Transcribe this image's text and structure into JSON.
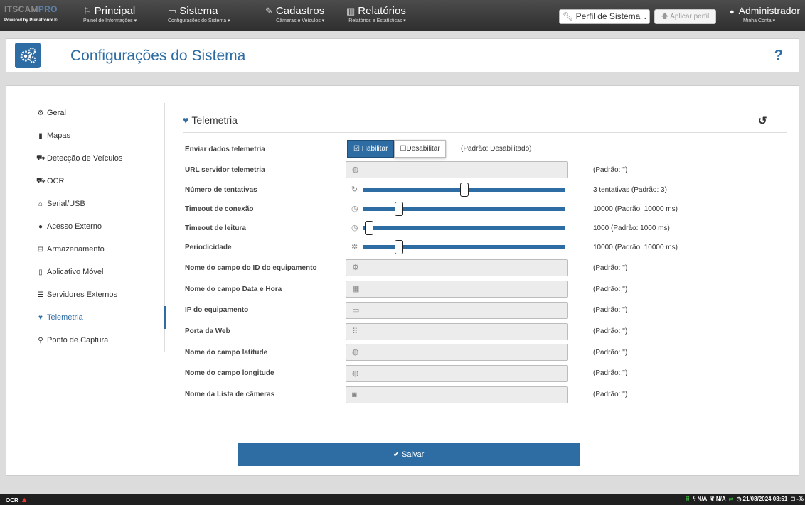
{
  "brand": {
    "line1_a": "ITSCAM",
    "line1_b": "PRO",
    "powered": "Powered by Pumatronix ®"
  },
  "nav": [
    {
      "icon": "flag-icon",
      "glyph": "⚐",
      "title": "Principal",
      "subtitle": "Painel de Informações ▾"
    },
    {
      "icon": "monitor-icon",
      "glyph": "▭",
      "title": "Sistema",
      "subtitle": "Configurações do Sistema ▾"
    },
    {
      "icon": "edit-icon",
      "glyph": "✎",
      "title": "Cadastros",
      "subtitle": "Câmeras e Veículos ▾"
    },
    {
      "icon": "bar-chart-icon",
      "glyph": "▥",
      "title": "Relatórios",
      "subtitle": "Relatórios e Estatísticas ▾"
    }
  ],
  "profile": {
    "select_label": "Perfil de Sistema",
    "apply_label": "Aplicar perfil"
  },
  "user": {
    "name": "Administrador",
    "account": "Minha Conta ▾"
  },
  "page": {
    "title": "Configurações do Sistema",
    "help": "?"
  },
  "sidebar": [
    {
      "icon": "cogs-icon",
      "glyph": "⚙",
      "label": "Geral"
    },
    {
      "icon": "map-icon",
      "glyph": "▮",
      "label": "Mapas"
    },
    {
      "icon": "car-icon",
      "glyph": "⛟",
      "label": "Detecção de Veículos"
    },
    {
      "icon": "car-icon",
      "glyph": "⛟",
      "label": "OCR"
    },
    {
      "icon": "plug-icon",
      "glyph": "⌂",
      "label": "Serial/USB"
    },
    {
      "icon": "globe-icon",
      "glyph": "●",
      "label": "Acesso Externo"
    },
    {
      "icon": "hdd-icon",
      "glyph": "⊟",
      "label": "Armazenamento"
    },
    {
      "icon": "mobile-icon",
      "glyph": "▯",
      "label": "Aplicativo Móvel"
    },
    {
      "icon": "server-icon",
      "glyph": "☰",
      "label": "Servidores Externos"
    },
    {
      "icon": "heartbeat-icon",
      "glyph": "♥",
      "label": "Telemetria"
    },
    {
      "icon": "map-marker-icon",
      "glyph": "⚲",
      "label": "Ponto de Captura"
    }
  ],
  "section": {
    "title": "Telemetria",
    "reset_glyph": "↺"
  },
  "enable": {
    "label": "Enviar dados telemetria",
    "on_label": "Habilitar",
    "off_label": "Desabilitar",
    "default_text": "(Padrão: Desabilitado)",
    "enabled": true
  },
  "url_field": {
    "label": "URL servidor telemetria",
    "icon": "globe-icon",
    "glyph": "◍",
    "value": "",
    "hint": "(Padrão: '')"
  },
  "sliders": [
    {
      "label": "Número de tentativas",
      "icon": "refresh-icon",
      "glyph": "↻",
      "level": 0.5,
      "hint": "3 tentativas  (Padrão: 3)"
    },
    {
      "label": "Timeout de conexão",
      "icon": "clock-icon",
      "glyph": "◷",
      "level": 0.18,
      "hint": "10000  (Padrão: 10000 ms)"
    },
    {
      "label": "Timeout de leitura",
      "icon": "clock-icon",
      "glyph": "◷",
      "level": 0.03,
      "hint": "1000  (Padrão: 1000 ms)"
    },
    {
      "label": "Periodicidade",
      "icon": "cog-icon",
      "glyph": "✲",
      "level": 0.18,
      "hint": "10000  (Padrão: 10000 ms)"
    }
  ],
  "fields": [
    {
      "label": "Nome do campo do ID do equipamento",
      "icon": "cogs-icon",
      "glyph": "⚙",
      "value": "",
      "hint": "(Padrão: '')"
    },
    {
      "label": "Nome do campo Data e Hora",
      "icon": "calendar-icon",
      "glyph": "▦",
      "value": "",
      "hint": "(Padrão: '')"
    },
    {
      "label": "IP do equipamento",
      "icon": "desktop-icon",
      "glyph": "▭",
      "value": "",
      "hint": "(Padrão: '')"
    },
    {
      "label": "Porta da Web",
      "icon": "sitemap-icon",
      "glyph": "⠿",
      "value": "",
      "hint": "(Padrão: '')"
    },
    {
      "label": "Nome do campo latitude",
      "icon": "globe-icon",
      "glyph": "◍",
      "value": "",
      "hint": "(Padrão: '')"
    },
    {
      "label": "Nome do campo longitude",
      "icon": "globe-icon",
      "glyph": "◍",
      "value": "",
      "hint": "(Padrão: '')"
    },
    {
      "label": "Nome da Lista de câmeras",
      "icon": "camera-icon",
      "glyph": "◙",
      "value": "",
      "hint": "(Padrão: '')"
    }
  ],
  "save_label": "Salvar",
  "status": {
    "left": "OCR",
    "na1": "N/A",
    "na2": "N/A",
    "datetime": "21/08/2024 08:51",
    "disk": "-%"
  },
  "colors": {
    "accent": "#2e6da4",
    "topbar": "#3a3a3a",
    "status_green": "#3db43d",
    "warning": "#e53935"
  }
}
